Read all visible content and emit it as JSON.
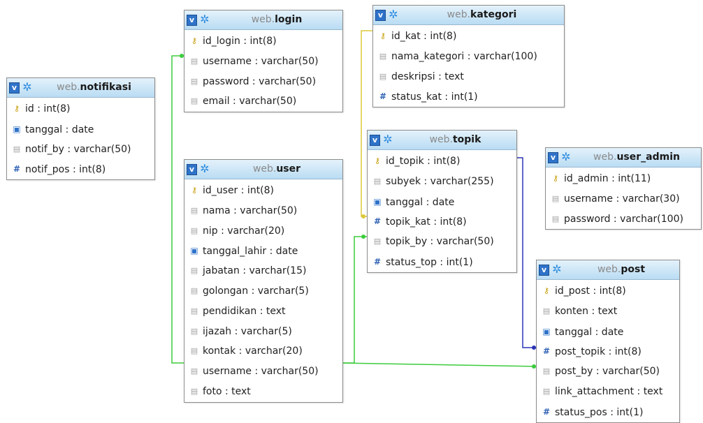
{
  "link_colors": {
    "yellow": "#dcc83a",
    "green": "#3ccc3c",
    "blue": "#2b33b8"
  },
  "tables": {
    "notifikasi": {
      "schema": "web.",
      "name": "notifikasi",
      "columns": [
        {
          "icon": "primary-key-icon",
          "label": "id : int(8)"
        },
        {
          "icon": "date-icon",
          "label": "tanggal : date"
        },
        {
          "icon": "text-icon",
          "label": "notif_by : varchar(50)"
        },
        {
          "icon": "number-icon",
          "label": "notif_pos : int(8)"
        }
      ]
    },
    "login": {
      "schema": "web.",
      "name": "login",
      "columns": [
        {
          "icon": "primary-key-icon",
          "label": "id_login : int(8)"
        },
        {
          "icon": "text-icon",
          "label": "username : varchar(50)"
        },
        {
          "icon": "text-icon",
          "label": "password : varchar(50)"
        },
        {
          "icon": "text-icon",
          "label": "email : varchar(50)"
        }
      ]
    },
    "kategori": {
      "schema": "web.",
      "name": "kategori",
      "columns": [
        {
          "icon": "primary-key-icon",
          "label": "id_kat : int(8)"
        },
        {
          "icon": "text-icon",
          "label": "nama_kategori : varchar(100)"
        },
        {
          "icon": "text-icon",
          "label": "deskripsi : text"
        },
        {
          "icon": "number-icon",
          "label": "status_kat : int(1)"
        }
      ]
    },
    "user": {
      "schema": "web.",
      "name": "user",
      "columns": [
        {
          "icon": "primary-key-icon",
          "label": "id_user : int(8)"
        },
        {
          "icon": "text-icon",
          "label": "nama : varchar(50)"
        },
        {
          "icon": "text-icon",
          "label": "nip : varchar(20)"
        },
        {
          "icon": "date-icon",
          "label": "tanggal_lahir : date"
        },
        {
          "icon": "text-icon",
          "label": "jabatan : varchar(15)"
        },
        {
          "icon": "text-icon",
          "label": "golongan : varchar(5)"
        },
        {
          "icon": "text-icon",
          "label": "pendidikan : text"
        },
        {
          "icon": "text-icon",
          "label": "ijazah : varchar(5)"
        },
        {
          "icon": "text-icon",
          "label": "kontak : varchar(20)"
        },
        {
          "icon": "text-icon",
          "label": "username : varchar(50)"
        },
        {
          "icon": "text-icon",
          "label": "foto : text"
        }
      ]
    },
    "topik": {
      "schema": "web.",
      "name": "topik",
      "columns": [
        {
          "icon": "primary-key-icon",
          "label": "id_topik : int(8)"
        },
        {
          "icon": "text-icon",
          "label": "subyek : varchar(255)"
        },
        {
          "icon": "date-icon",
          "label": "tanggal : date"
        },
        {
          "icon": "number-icon",
          "label": "topik_kat : int(8)"
        },
        {
          "icon": "text-icon",
          "label": "topik_by : varchar(50)"
        },
        {
          "icon": "number-icon",
          "label": "status_top : int(1)"
        }
      ]
    },
    "user_admin": {
      "schema": "web.",
      "name": "user_admin",
      "columns": [
        {
          "icon": "primary-key-icon",
          "label": "id_admin : int(11)"
        },
        {
          "icon": "text-icon",
          "label": "username : varchar(30)"
        },
        {
          "icon": "text-icon",
          "label": "password : varchar(100)"
        }
      ]
    },
    "post": {
      "schema": "web.",
      "name": "post",
      "columns": [
        {
          "icon": "primary-key-icon",
          "label": "id_post : int(8)"
        },
        {
          "icon": "text-icon",
          "label": "konten : text"
        },
        {
          "icon": "date-icon",
          "label": "tanggal : date"
        },
        {
          "icon": "number-icon",
          "label": "post_topik : int(8)"
        },
        {
          "icon": "text-icon",
          "label": "post_by : varchar(50)"
        },
        {
          "icon": "text-icon",
          "label": "link_attachment : text"
        },
        {
          "icon": "number-icon",
          "label": "status_pos : int(1)"
        }
      ]
    }
  }
}
